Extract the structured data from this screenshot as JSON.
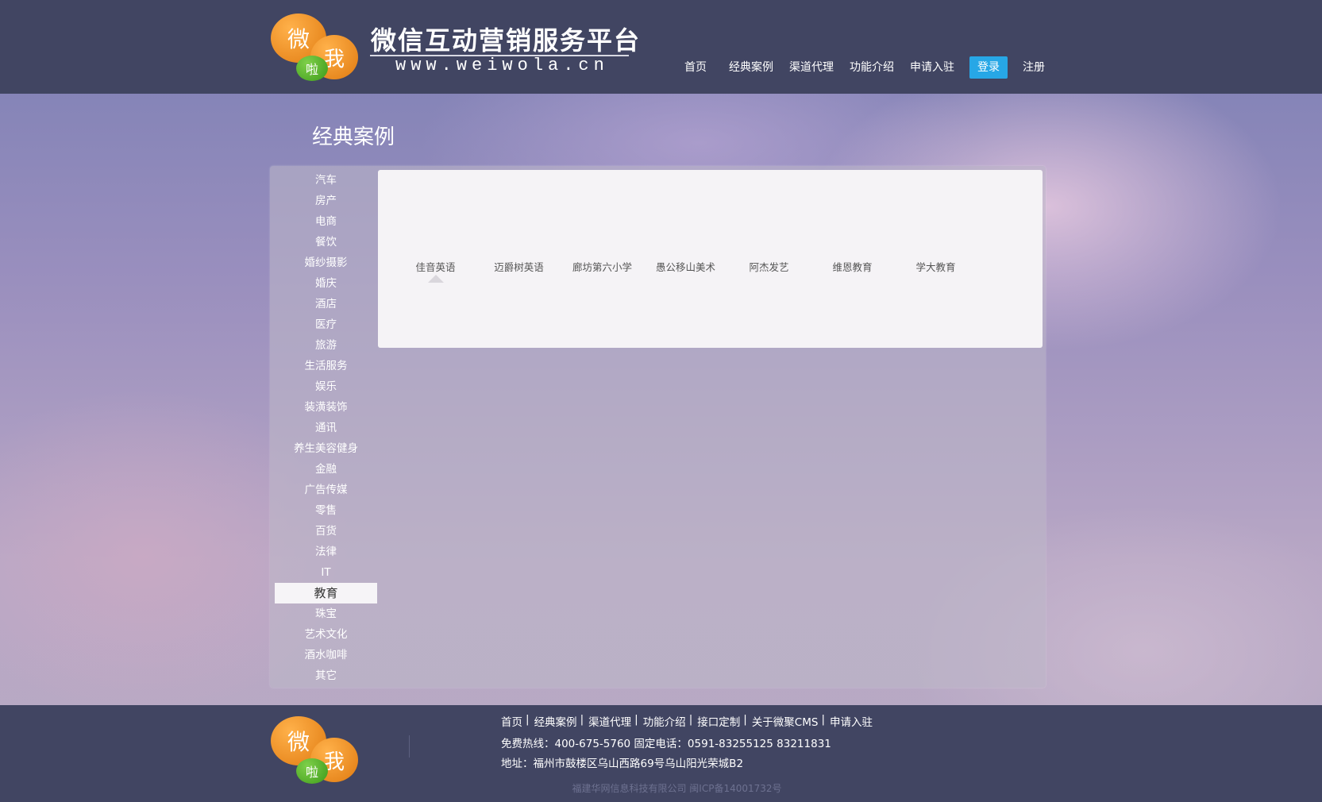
{
  "header": {
    "logo_chars": [
      "微",
      "我",
      "啦"
    ],
    "brand_title": "微信互动营销服务平台",
    "brand_url": "www.weiwola.cn",
    "nav": [
      {
        "label": "首页"
      },
      {
        "label": "经典案例"
      },
      {
        "label": "渠道代理"
      },
      {
        "label": "功能介绍"
      },
      {
        "label": "申请入驻"
      },
      {
        "label": "登录",
        "active": true
      },
      {
        "label": "注册"
      }
    ],
    "accent_color": "#27a7e6"
  },
  "page_title": "经典案例",
  "sidebar": {
    "items": [
      "汽车",
      "房产",
      "电商",
      "餐饮",
      "婚纱摄影",
      "婚庆",
      "酒店",
      "医疗",
      "旅游",
      "生活服务",
      "娱乐",
      "装潢装饰",
      "通讯",
      "养生美容健身",
      "金融",
      "广告传媒",
      "零售",
      "百货",
      "法律",
      "IT",
      "教育",
      "珠宝",
      "艺术文化",
      "酒水咖啡",
      "其它"
    ],
    "active": "教育"
  },
  "cases": {
    "items": [
      "佳音英语",
      "迈爵树英语",
      "廊坊第六小学",
      "愚公移山美术",
      "阿杰发艺",
      "维恩教育",
      "学大教育"
    ],
    "selected": "佳音英语"
  },
  "footer": {
    "links": [
      "首页",
      "经典案例",
      "渠道代理",
      "功能介绍",
      "接口定制",
      "关于微聚CMS",
      "申请入驻"
    ],
    "separator": "|",
    "hotline": "免费热线：400-675-5760   固定电话：0591-83255125 83211831",
    "address": "地址：福州市鼓楼区乌山西路69号乌山阳光荣城B2",
    "copyright": "福建华网信息科技有限公司 闽ICP备14001732号"
  }
}
